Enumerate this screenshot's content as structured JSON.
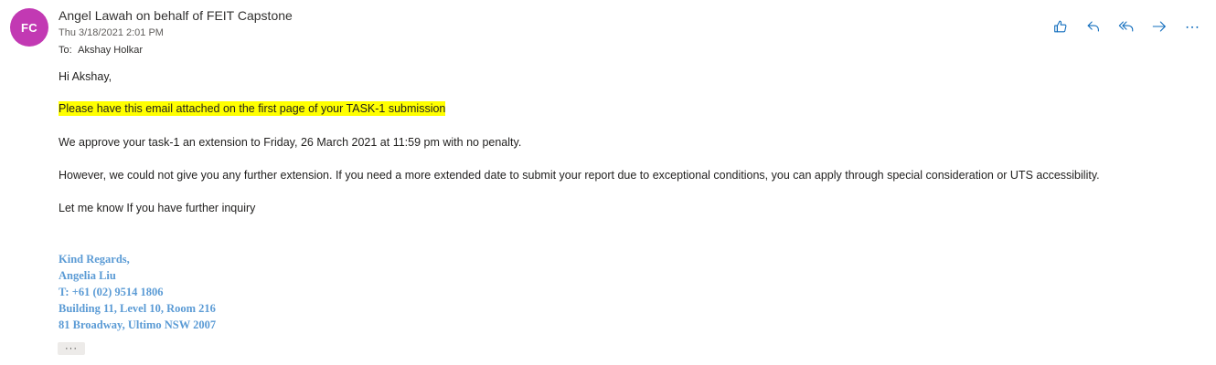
{
  "avatar": {
    "initials": "FC",
    "color": "#c239b3"
  },
  "header": {
    "sender": "Angel Lawah on behalf of FEIT Capstone",
    "datetime": "Thu 3/18/2021 2:01 PM",
    "to_label": "To:",
    "to_name": "Akshay Holkar"
  },
  "actions": [
    {
      "icon": "like-icon"
    },
    {
      "icon": "reply-icon"
    },
    {
      "icon": "reply-all-icon"
    },
    {
      "icon": "forward-icon"
    },
    {
      "icon": "more-actions-icon"
    }
  ],
  "message": {
    "greeting": "Hi Akshay,",
    "highlighted": "Please have this email attached on the first page of your TASK-1 submission",
    "highlight_color": "#ffff00",
    "approve": "We approve your task-1 an extension to Friday, 26 March 2021 at 11:59 pm with no penalty.",
    "further": "However, we could not give you any further extension. If you need a more extended date to submit your report due to exceptional conditions, you can apply through special consideration or UTS accessibility.",
    "inquiry": "Let me know If you have further inquiry"
  },
  "signature": {
    "color": "#5b9bd5",
    "lines": [
      "Kind Regards,",
      "Angelia Liu",
      "T: +61 (02) 9514 1806",
      "Building 11, Level 10, Room 216",
      "81 Broadway, Ultimo NSW 2007"
    ]
  },
  "show_more": {
    "label": "···"
  },
  "accent_color": "#0f6cbd"
}
